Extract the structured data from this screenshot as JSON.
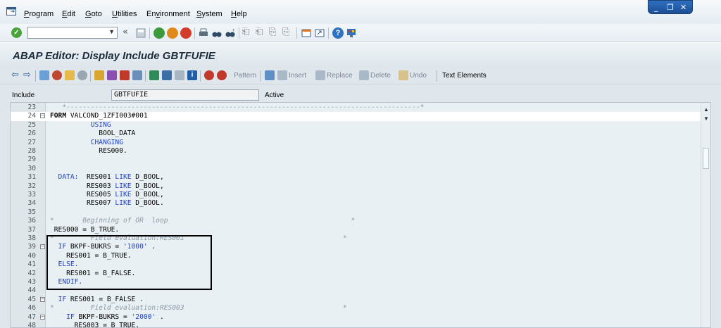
{
  "menubar": {
    "items": [
      {
        "label": "Program",
        "accel": "P"
      },
      {
        "label": "Edit",
        "accel": "E"
      },
      {
        "label": "Goto",
        "accel": "G"
      },
      {
        "label": "Utilities",
        "accel": "U"
      },
      {
        "label": "Environment",
        "accel": "v"
      },
      {
        "label": "System",
        "accel": "S"
      },
      {
        "label": "Help",
        "accel": "H"
      }
    ]
  },
  "window_controls": {
    "minimize": "_",
    "restore": "❐",
    "close": "✕"
  },
  "systoolbar": {
    "command_value": "",
    "back_glyph": "«"
  },
  "title": "ABAP Editor: Display Include GBTFUFIE",
  "apptoolbar": {
    "pattern": "Pattern",
    "insert": "Insert",
    "replace": "Replace",
    "delete": "Delete",
    "undo": "Undo",
    "text_elements": "Text Elements"
  },
  "include": {
    "label": "Include",
    "value": "GBTFUFIE",
    "status": "Active"
  },
  "editor": {
    "lines": [
      {
        "n": "23",
        "fold": "",
        "hl": false,
        "parts": [
          {
            "t": "   *---------------------------------------------------------------------------------------*",
            "c": "cm"
          }
        ]
      },
      {
        "n": "24",
        "fold": "⊟",
        "hl": true,
        "parts": [
          {
            "t": "FORM ",
            "c": "kwb"
          },
          {
            "t": "VALCOND_1ZFI003#001",
            "c": ""
          }
        ]
      },
      {
        "n": "25",
        "fold": "",
        "hl": false,
        "parts": [
          {
            "t": "          USING",
            "c": "kw"
          }
        ]
      },
      {
        "n": "26",
        "fold": "",
        "hl": false,
        "parts": [
          {
            "t": "            BOOL_DATA",
            "c": ""
          }
        ]
      },
      {
        "n": "27",
        "fold": "",
        "hl": false,
        "parts": [
          {
            "t": "          CHANGING",
            "c": "kw"
          }
        ]
      },
      {
        "n": "28",
        "fold": "",
        "hl": false,
        "parts": [
          {
            "t": "            RES000.",
            "c": ""
          }
        ]
      },
      {
        "n": "29",
        "fold": "",
        "hl": false,
        "parts": []
      },
      {
        "n": "30",
        "fold": "",
        "hl": false,
        "parts": []
      },
      {
        "n": "31",
        "fold": "",
        "hl": false,
        "parts": [
          {
            "t": "  DATA:  ",
            "c": "kw"
          },
          {
            "t": "RES001 ",
            "c": ""
          },
          {
            "t": "LIKE",
            "c": "kw"
          },
          {
            "t": " D_BOOL,",
            "c": ""
          }
        ]
      },
      {
        "n": "32",
        "fold": "",
        "hl": false,
        "parts": [
          {
            "t": "         RES003 ",
            "c": ""
          },
          {
            "t": "LIKE",
            "c": "kw"
          },
          {
            "t": " D_BOOL,",
            "c": ""
          }
        ]
      },
      {
        "n": "33",
        "fold": "",
        "hl": false,
        "parts": [
          {
            "t": "         RES005 ",
            "c": ""
          },
          {
            "t": "LIKE",
            "c": "kw"
          },
          {
            "t": " D_BOOL,",
            "c": ""
          }
        ]
      },
      {
        "n": "34",
        "fold": "",
        "hl": false,
        "parts": [
          {
            "t": "         RES007 ",
            "c": ""
          },
          {
            "t": "LIKE",
            "c": "kw"
          },
          {
            "t": " D_BOOL.",
            "c": ""
          }
        ]
      },
      {
        "n": "35",
        "fold": "",
        "hl": false,
        "parts": []
      },
      {
        "n": "36",
        "fold": "",
        "hl": false,
        "parts": [
          {
            "t": "*       Beginning of OR  loop                                             *",
            "c": "cm"
          }
        ]
      },
      {
        "n": "37",
        "fold": "",
        "hl": false,
        "parts": [
          {
            "t": " RES000 = B_TRUE.",
            "c": ""
          }
        ]
      },
      {
        "n": "38",
        "fold": "",
        "hl": false,
        "parts": [
          {
            "t": "*         Field evaluation:RES001                                       *",
            "c": "cm"
          }
        ]
      },
      {
        "n": "39",
        "fold": "⊟",
        "hl": false,
        "parts": [
          {
            "t": "  IF ",
            "c": "kw"
          },
          {
            "t": "BKPF-BUKRS = ",
            "c": ""
          },
          {
            "t": "'1000'",
            "c": "str"
          },
          {
            "t": " .",
            "c": ""
          }
        ]
      },
      {
        "n": "40",
        "fold": "",
        "hl": false,
        "parts": [
          {
            "t": "    RES001 = B_TRUE.",
            "c": ""
          }
        ]
      },
      {
        "n": "41",
        "fold": "",
        "hl": false,
        "parts": [
          {
            "t": "  ELSE.",
            "c": "kw"
          }
        ]
      },
      {
        "n": "42",
        "fold": "",
        "hl": false,
        "parts": [
          {
            "t": "    RES001 = B_FALSE.",
            "c": ""
          }
        ]
      },
      {
        "n": "43",
        "fold": "",
        "hl": false,
        "parts": [
          {
            "t": "  ENDIF.",
            "c": "kw"
          }
        ]
      },
      {
        "n": "44",
        "fold": "",
        "hl": false,
        "parts": []
      },
      {
        "n": "45",
        "fold": "⊟",
        "hl": false,
        "parts": [
          {
            "t": "  IF ",
            "c": "kw"
          },
          {
            "t": "RES001 = B_FALSE .",
            "c": ""
          }
        ]
      },
      {
        "n": "46",
        "fold": "",
        "hl": false,
        "parts": [
          {
            "t": "*         Field evaluation:RES003                                       *",
            "c": "cm"
          }
        ]
      },
      {
        "n": "47",
        "fold": "⊟",
        "hl": false,
        "parts": [
          {
            "t": "    IF ",
            "c": "kw"
          },
          {
            "t": "BKPF-BUKRS = ",
            "c": ""
          },
          {
            "t": "'2000'",
            "c": "str"
          },
          {
            "t": " .",
            "c": ""
          }
        ]
      },
      {
        "n": "48",
        "fold": "",
        "hl": false,
        "parts": [
          {
            "t": "      RES003 = B_TRUE.",
            "c": ""
          }
        ]
      }
    ]
  }
}
